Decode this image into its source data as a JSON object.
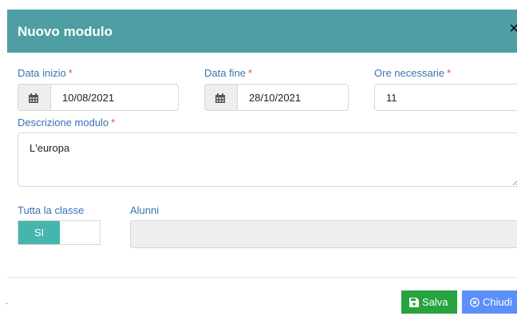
{
  "modal": {
    "title": "Nuovo modulo",
    "close_glyph": "×"
  },
  "form": {
    "start_date": {
      "label": "Data inizio",
      "required_mark": "*",
      "value": "10/08/2021",
      "icon": "calendar-icon"
    },
    "end_date": {
      "label": "Data fine",
      "required_mark": "*",
      "value": "28/10/2021",
      "icon": "calendar-icon"
    },
    "hours": {
      "label": "Ore necessarie",
      "required_mark": "*",
      "value": "11"
    },
    "description": {
      "label": "Descrizione modulo",
      "required_mark": "*",
      "value": "L'europa"
    },
    "whole_class": {
      "label": "Tutta la classe",
      "toggle_on_label": "SI"
    },
    "students": {
      "label": "Alunni",
      "value": ""
    }
  },
  "footer": {
    "save_label": "Salva",
    "close_label": "Chiudi",
    "save_color": "#26a33e",
    "close_color": "#5b8ff9"
  },
  "colors": {
    "header_bg": "#4e9ea4",
    "label_color": "#3c72b5",
    "required_color": "#d9534f",
    "toggle_on": "#44b6ae"
  }
}
